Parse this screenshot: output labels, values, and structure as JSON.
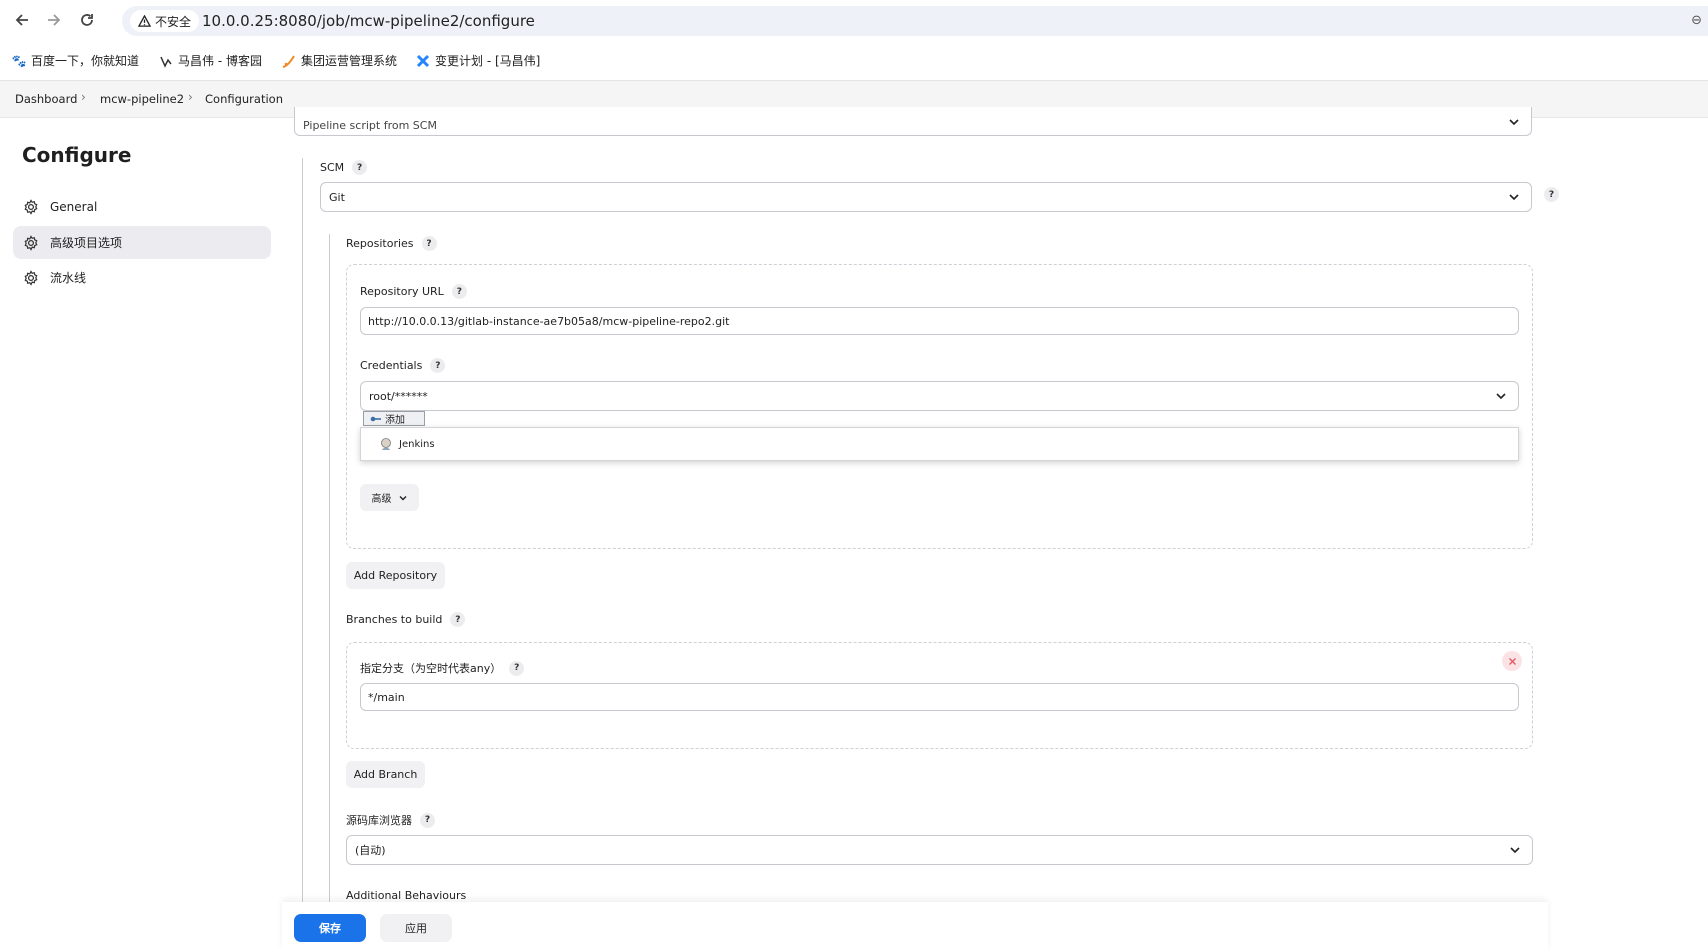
{
  "browser": {
    "security_label": "不安全",
    "url": "10.0.0.25:8080/job/mcw-pipeline2/configure",
    "bookmarks": [
      {
        "label": "百度一下，你就知道",
        "icon": "baidu-paw-icon"
      },
      {
        "label": "马昌伟 - 博客园",
        "icon": "cnblogs-icon"
      },
      {
        "label": "集团运营管理系统",
        "icon": "ops-system-icon"
      },
      {
        "label": "变更计划 - [马昌伟]",
        "icon": "jira-icon"
      }
    ]
  },
  "breadcrumb": [
    "Dashboard",
    "mcw-pipeline2",
    "Configuration"
  ],
  "sidebar": {
    "title": "Configure",
    "items": [
      {
        "label": "General",
        "icon": "gear-icon",
        "active": false
      },
      {
        "label": "高级项目选项",
        "icon": "gear-icon",
        "active": true
      },
      {
        "label": "流水线",
        "icon": "gear-icon",
        "active": false
      }
    ]
  },
  "form": {
    "definition_value": "Pipeline script from SCM",
    "scm_label": "SCM",
    "scm_value": "Git",
    "repositories_label": "Repositories",
    "repo_url_label": "Repository URL",
    "repo_url_value": "http://10.0.0.13/gitlab-instance-ae7b05a8/mcw-pipeline-repo2.git",
    "credentials_label": "Credentials",
    "credentials_value": "root/******",
    "add_button_label": "添加",
    "add_dropdown_items": [
      "Jenkins"
    ],
    "advanced_label": "高级",
    "add_repository_label": "Add Repository",
    "branches_label": "Branches to build",
    "branch_specifier_label": "指定分支（为空时代表any）",
    "branch_value": "*/main",
    "add_branch_label": "Add Branch",
    "repo_browser_label": "源码库浏览器",
    "repo_browser_value": "(自动)",
    "additional_behaviours_label": "Additional Behaviours",
    "help_glyph": "?"
  },
  "footer": {
    "save_label": "保存",
    "apply_label": "应用"
  },
  "colors": {
    "primary": "#1a73e8",
    "sidebar_active_bg": "#ececf0",
    "breadcrumb_bg": "#f5f5f6",
    "delete_icon": "#e0555f"
  }
}
